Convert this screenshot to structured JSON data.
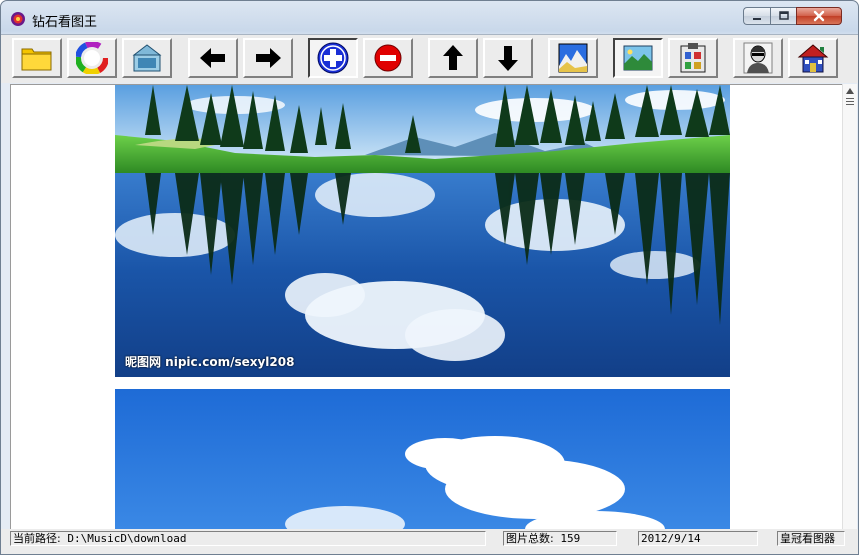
{
  "window": {
    "title": "钻石看图王"
  },
  "toolbar": {
    "buttons": [
      {
        "name": "open-folder-button",
        "icon": "folder-icon"
      },
      {
        "name": "color-wheel-button",
        "icon": "color-wheel-icon"
      },
      {
        "name": "slideshow-button",
        "icon": "picture-frame-icon"
      },
      {
        "name": "previous-button",
        "icon": "arrow-left-icon"
      },
      {
        "name": "next-button",
        "icon": "arrow-right-icon"
      },
      {
        "name": "zoom-in-button",
        "icon": "plus-circle-icon"
      },
      {
        "name": "zoom-out-button",
        "icon": "minus-circle-icon"
      },
      {
        "name": "scroll-up-button",
        "icon": "arrow-up-icon"
      },
      {
        "name": "scroll-down-button",
        "icon": "arrow-down-icon"
      },
      {
        "name": "thumbnail-view-button",
        "icon": "mountain-thumbnail-icon"
      },
      {
        "name": "landscape-view-button",
        "icon": "landscape-icon"
      },
      {
        "name": "clipboard-button",
        "icon": "clipboard-icon"
      },
      {
        "name": "about-button",
        "icon": "person-icon"
      },
      {
        "name": "home-button",
        "icon": "house-icon"
      }
    ],
    "pressed": "zoom-in-button",
    "colors": {
      "zoom_in": "#1a2fd6",
      "zoom_out": "#e00000",
      "folder": "#f5c400"
    }
  },
  "content": {
    "watermark": "昵图网 nipic.com/sexyl208"
  },
  "status": {
    "path_label": "当前路径:",
    "path_value": "D:\\MusicD\\download",
    "count_label": "图片总数:",
    "count_value": "159",
    "date": "2012/9/14",
    "app_name": "皇冠看图器"
  }
}
